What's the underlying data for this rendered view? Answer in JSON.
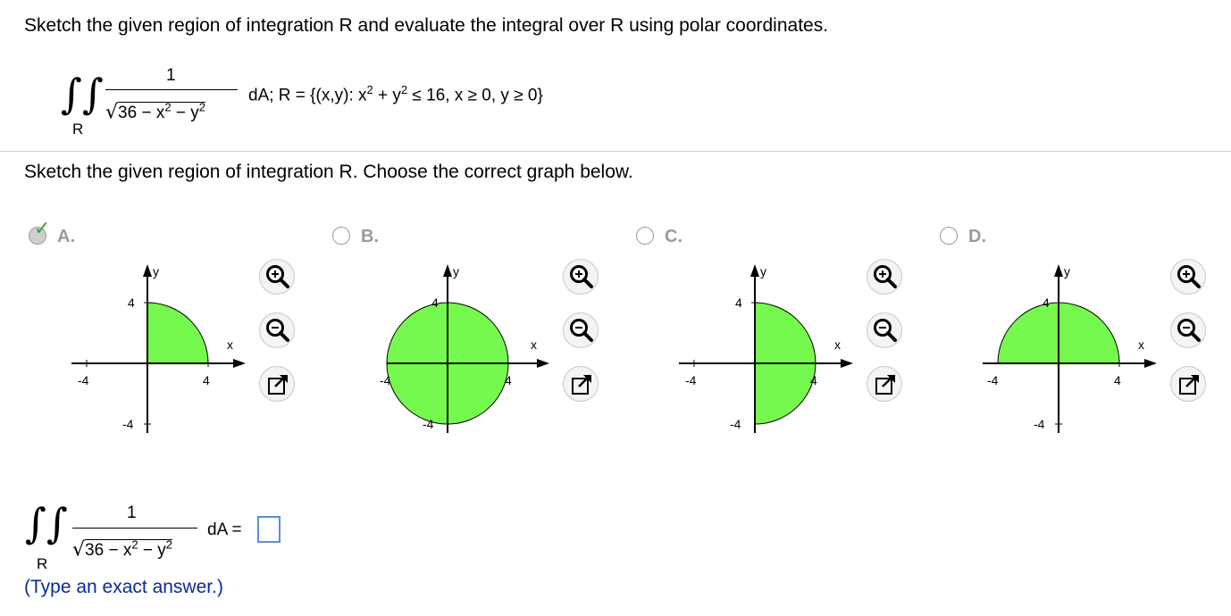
{
  "question": {
    "prompt": "Sketch the given region of integration R and evaluate the integral over R using polar coordinates.",
    "numerator": "1",
    "denominator": "36 − x",
    "exp_2": "2",
    "minus_y": " − y",
    "differential": "dA; R = ",
    "region_set": "{(x,y): x",
    "region_rest1": " + y",
    "region_rest2": " ≤ 16, x ≥ 0, y ≥ 0}",
    "region_label": "R"
  },
  "part1": {
    "prompt": "Sketch the given region of integration R. Choose the correct graph below.",
    "choices": [
      {
        "label": "A.",
        "selected": true,
        "shape": "quarter-disk-q1"
      },
      {
        "label": "B.",
        "selected": false,
        "shape": "full-disk"
      },
      {
        "label": "C.",
        "selected": false,
        "shape": "right-half-disk"
      },
      {
        "label": "D.",
        "selected": false,
        "shape": "upper-half-disk"
      }
    ],
    "axis": {
      "x_label": "x",
      "y_label": "y",
      "tick_pos": "4",
      "tick_neg": "-4",
      "fill_color": "#76f94e"
    },
    "tools": [
      "zoom-in-icon",
      "zoom-out-icon",
      "popout-icon"
    ]
  },
  "part2": {
    "numerator": "1",
    "denominator": "36 − x",
    "exp_2": "2",
    "minus_y": " − y",
    "differential": "dA =",
    "region_label": "R",
    "answer_value": "",
    "hint": "(Type an exact answer.)"
  },
  "colors": {
    "accent_check": "#3aa13a",
    "hint_text": "#0b2a9a",
    "answer_border": "#5b8fd6"
  }
}
